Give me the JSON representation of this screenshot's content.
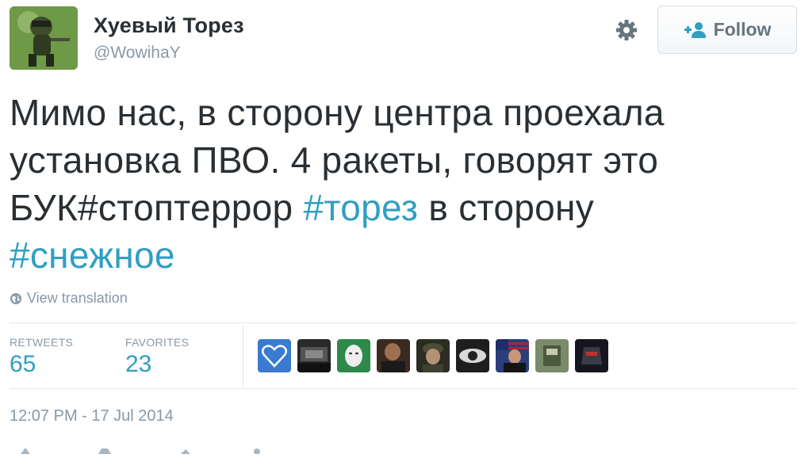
{
  "user": {
    "name": "Хуевый Торез",
    "handle": "@WowihaY"
  },
  "follow_button": {
    "label": "Follow"
  },
  "tweet": {
    "line1": "Мимо нас, в сторону центра проехала",
    "line2": "установка ПВО. 4 ракеты, говорят это",
    "line3_text": "БУК#стоптеррор ",
    "line3_hashtag": "#торез",
    "line3_tail": " в сторону",
    "line4_hashtag": "#снежное"
  },
  "translate": {
    "label": "View translation"
  },
  "stats": {
    "retweets_label": "RETWEETS",
    "retweets_value": "65",
    "favorites_label": "FAVORITES",
    "favorites_value": "23"
  },
  "timestamp": "12:07 PM - 17 Jul 2014",
  "colors": {
    "link": "#2f9fc2",
    "muted": "#8899a6",
    "text": "#292f33"
  }
}
